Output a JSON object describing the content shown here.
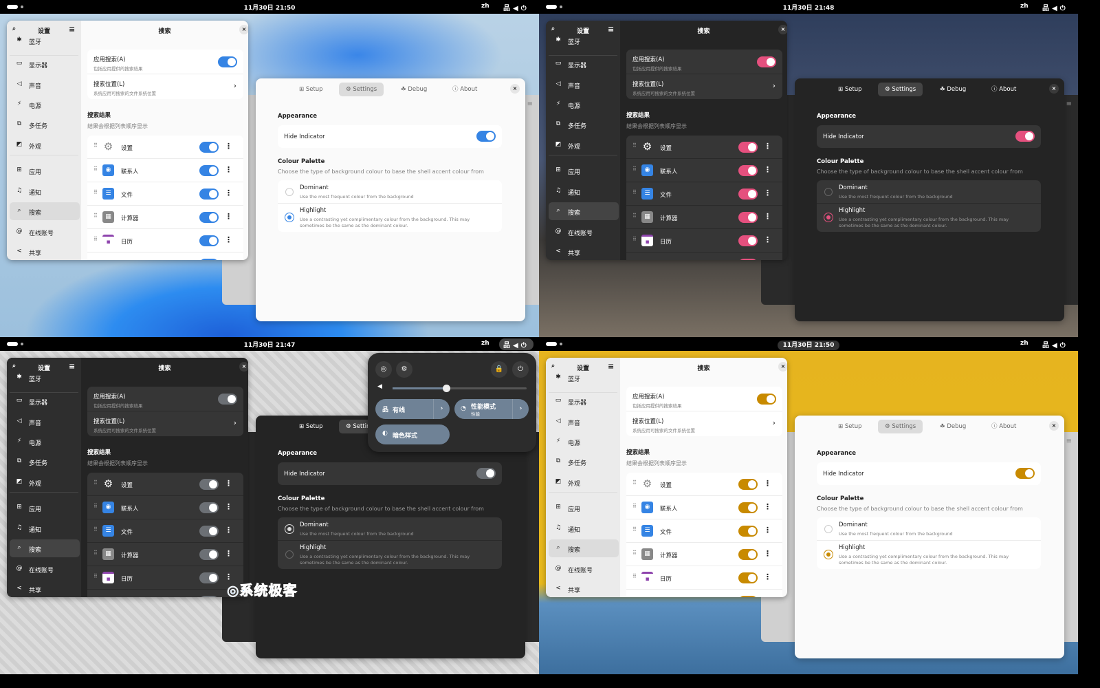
{
  "topbar": {
    "lang": "zh",
    "system_icons": "network volume power"
  },
  "settings": {
    "title": "设置",
    "page_title": "搜索",
    "close": "×",
    "sidebar": [
      {
        "label": "蓝牙",
        "icon": "bluetooth-icon",
        "glyph": "✱"
      },
      {
        "label": "显示器",
        "icon": "display-icon",
        "glyph": "▭"
      },
      {
        "label": "声音",
        "icon": "speaker-icon",
        "glyph": "◁"
      },
      {
        "label": "电源",
        "icon": "power-icon",
        "glyph": "⚡"
      },
      {
        "label": "多任务",
        "icon": "multitasking-icon",
        "glyph": "⧉"
      },
      {
        "label": "外观",
        "icon": "appearance-icon",
        "glyph": "◩"
      },
      {
        "label": "应用",
        "icon": "apps-icon",
        "glyph": "⊞"
      },
      {
        "label": "通知",
        "icon": "bell-icon",
        "glyph": "♫"
      },
      {
        "label": "搜索",
        "icon": "search-icon",
        "glyph": "⌕"
      },
      {
        "label": "在线账号",
        "icon": "at-icon",
        "glyph": "@"
      },
      {
        "label": "共享",
        "icon": "share-icon",
        "glyph": "<"
      }
    ],
    "active_item": "搜索",
    "app_search": {
      "title": "应用搜索(A)",
      "subtitle": "包括应用提供的搜索结果"
    },
    "search_locations": {
      "title": "搜索位置(L)",
      "subtitle": "系统应用可搜索的文件系统位置"
    },
    "results_title": "搜索结果",
    "results_subtitle": "结果会根据列表顺序显示",
    "results": [
      {
        "label": "设置",
        "icon": "settings-app-icon",
        "glyph": "⚙",
        "color": "#9a9a9a",
        "enabled": true
      },
      {
        "label": "联系人",
        "icon": "contacts-app-icon",
        "glyph": "◉",
        "color": "#3584e4",
        "enabled": true
      },
      {
        "label": "文件",
        "icon": "files-app-icon",
        "glyph": "☰",
        "color": "#3584e4",
        "enabled": true
      },
      {
        "label": "计算器",
        "icon": "calculator-app-icon",
        "glyph": "▦",
        "color": "#888888",
        "enabled": true
      },
      {
        "label": "日历",
        "icon": "calendar-app-icon",
        "glyph": "▪",
        "color": "#8e44ad",
        "enabled": true
      }
    ]
  },
  "extension": {
    "tabs": [
      "Setup",
      "Settings",
      "Debug",
      "About"
    ],
    "active_tab": "Settings",
    "appearance": "Appearance",
    "hide_indicator": "Hide Indicator",
    "palette_title": "Colour Palette",
    "palette_desc": "Choose the type of background colour to base the shell accent colour from",
    "dominant": {
      "title": "Dominant",
      "desc": "Use the most frequent colour from the background"
    },
    "highlight": {
      "title": "Highlight",
      "desc1": "Use a contrasting yet complimentary colour from the background. This may",
      "desc2": "sometimes be the same as the dominant colour."
    }
  },
  "quadrants": [
    {
      "clock": "11月30日 21:50",
      "theme": "light",
      "accent": "#3584e4",
      "palette": "Highlight",
      "hide_indicator": true
    },
    {
      "clock": "11月30日 21:48",
      "theme": "dark",
      "accent": "#e5507e",
      "palette": "Highlight",
      "hide_indicator": true
    },
    {
      "clock": "11月30日 21:47",
      "theme": "dark",
      "accent": "#6c7075",
      "palette": "Dominant",
      "hide_indicator": true
    },
    {
      "clock": "11月30日 21:50",
      "theme": "light",
      "accent": "#c88a00",
      "palette": "Highlight",
      "hide_indicator": true
    }
  ],
  "quick_settings": {
    "volume_percent": 40,
    "wired": "有线",
    "power_mode": "性能模式",
    "power_mode_sub": "性能",
    "dark_style": "暗色样式"
  },
  "watermark": "系统极客"
}
